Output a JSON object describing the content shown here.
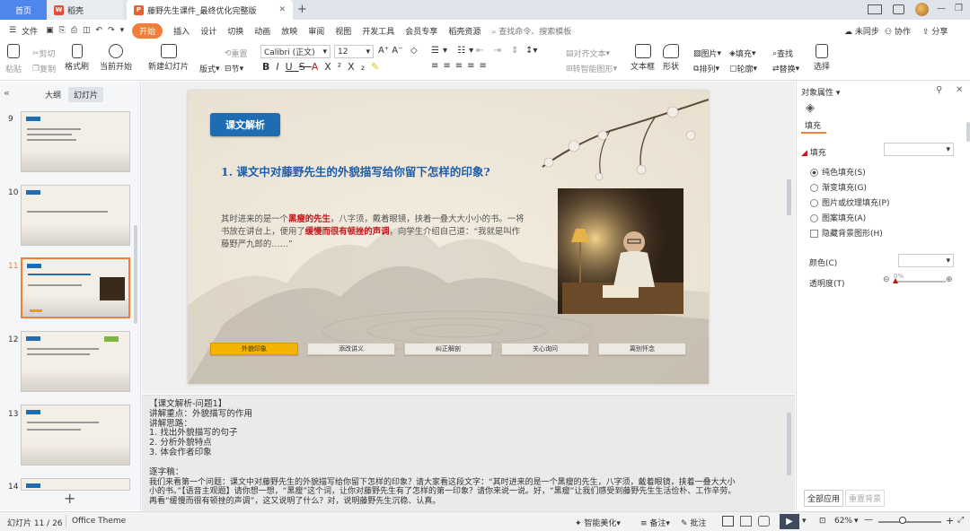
{
  "tabs": {
    "home": "首页",
    "wps": "稻壳",
    "doc": "藤野先生课件_最终优化完整版"
  },
  "menu": {
    "file": "文件",
    "start": "开始",
    "items": [
      "插入",
      "设计",
      "切换",
      "动画",
      "放映",
      "审阅",
      "视图",
      "开发工具",
      "会员专享",
      "稻壳资源"
    ],
    "search": "查找命令、搜索模板",
    "sync": "未同步",
    "collab": "协作",
    "share": "分享"
  },
  "ribbon": {
    "paste": "粘贴",
    "cut": "剪切",
    "copy": "复制",
    "format_painter": "格式刷",
    "play": "当前开始",
    "new_slide": "新建幻灯片",
    "layout": "版式",
    "section": "节",
    "reset": "重置",
    "font": "Calibri (正文)",
    "size": "12",
    "text_box": "文本框",
    "shape": "形状",
    "arrange": "排列",
    "picture": "图片",
    "fill": "填充",
    "outline": "轮廓",
    "find": "查找",
    "replace": "替换",
    "select": "选择",
    "align_text": "对齐文本",
    "smart_art": "转智能图形"
  },
  "panel": {
    "outline_tab": "大纲",
    "slides_tab": "幻灯片",
    "thumbnails": [
      "9",
      "10",
      "11",
      "12",
      "13",
      "14"
    ]
  },
  "slide": {
    "label": "课文解析",
    "question": "1. 课文中对藤野先生的外貌描写给你留下怎样的印象?",
    "p_a": "其时进来的是一个",
    "p_red1": "黑瘦的先生",
    "p_b": "，八字须，戴着眼镜，挟着一叠大大小小的书。一将书放在讲台上，便用了",
    "p_red2": "缓慢而很有顿挫的声调",
    "p_c": "，向学生介绍自己道：“我就是叫作藤野严九郎的……”",
    "nav": [
      "外貌印象",
      "添改讲义",
      "纠正解剖",
      "关心询问",
      "离别怀念"
    ]
  },
  "notes": {
    "lines": [
      "【课文解析-问题1】",
      "讲解重点：外貌描写的作用",
      "讲解思路：",
      "1. 找出外貌描写的句子",
      "2. 分析外貌特点",
      "3. 体会作者印象",
      "",
      "逐字稿：",
      "我们来看第一个问题：课文中对藤野先生的外貌描写给你留下怎样的印象？请大家看这段文字：“其时进来的是一个黑瘦的先生，八字须，戴着眼镜，挟着一叠大大小",
      "小的书。”【语音主观题】请你想一想，“黑瘦”这个词，让你对藤野先生有了怎样的第一印象？请你来说一说。好，“黑瘦”让我们感受到藤野先生生活俭朴、工作辛劳。",
      "再看“缓慢而很有顿挫的声调”，这又说明了什么？对，说明藤野先生沉稳、认真。"
    ]
  },
  "right": {
    "title": "对象属性",
    "fill_tab": "填充",
    "fill_section": "填充",
    "options": [
      "纯色填充(S)",
      "渐变填充(G)",
      "图片或纹理填充(P)",
      "图案填充(A)"
    ],
    "hide_bg": "隐藏背景图形(H)",
    "color": "颜色(C)",
    "transparency": "透明度(T)",
    "transparency_value": "0%",
    "apply_all": "全部应用",
    "reset_bg": "重置背景"
  },
  "status": {
    "slide_info": "幻灯片 11 / 26",
    "theme": "Office Theme",
    "beautify": "智能美化",
    "notes": "备注",
    "comment": "批注",
    "zoom": "62%"
  },
  "colors": {
    "accent": "#f27e3a",
    "blue_label": "#1e6db3",
    "red_text": "#c3161c"
  }
}
